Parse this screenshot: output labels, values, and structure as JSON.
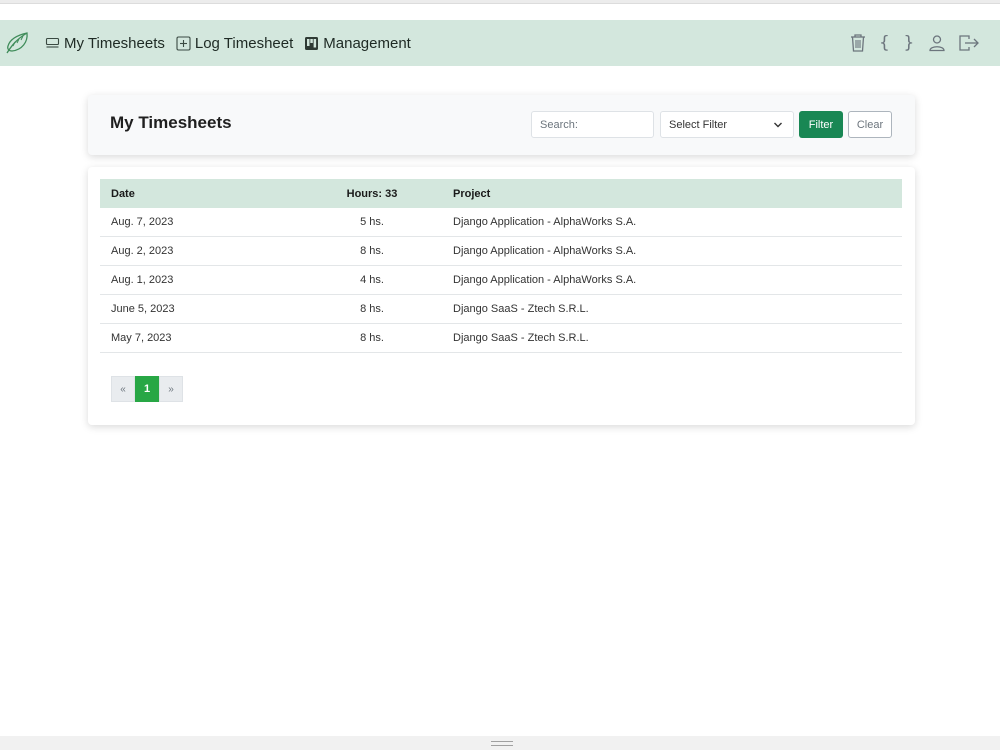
{
  "navbar": {
    "brand_icon": "leaf-icon",
    "links": [
      {
        "label": "My Timesheets",
        "icon": "card-list-icon"
      },
      {
        "label": "Log Timesheet",
        "icon": "plus-square-icon"
      },
      {
        "label": "Management",
        "icon": "kanban-icon"
      }
    ],
    "right_icons": [
      "trash-icon",
      "braces-icon",
      "person-icon",
      "logout-icon"
    ],
    "braces_text": "{ }",
    "background": "#d3e7dd"
  },
  "header": {
    "title": "My Timesheets",
    "search_placeholder": "Search:",
    "select_value": "Select Filter",
    "filter_label": "Filter",
    "clear_label": "Clear"
  },
  "table": {
    "headers": {
      "date": "Date",
      "hours": "Hours: 33",
      "project": "Project"
    },
    "rows": [
      {
        "date": "Aug. 7, 2023",
        "hours": "5 hs.",
        "project": "Django Application - AlphaWorks S.A."
      },
      {
        "date": "Aug. 2, 2023",
        "hours": "8 hs.",
        "project": "Django Application - AlphaWorks S.A."
      },
      {
        "date": "Aug. 1, 2023",
        "hours": "4 hs.",
        "project": "Django Application - AlphaWorks S.A."
      },
      {
        "date": "June 5, 2023",
        "hours": "8 hs.",
        "project": "Django SaaS - Ztech S.R.L."
      },
      {
        "date": "May 7, 2023",
        "hours": "8 hs.",
        "project": "Django SaaS - Ztech S.R.L."
      }
    ]
  },
  "pagination": {
    "prev": "«",
    "current": "1",
    "next": "»"
  },
  "colors": {
    "accent": "#198754",
    "active_page": "#28a745",
    "header_bg": "#d3e7dd"
  }
}
